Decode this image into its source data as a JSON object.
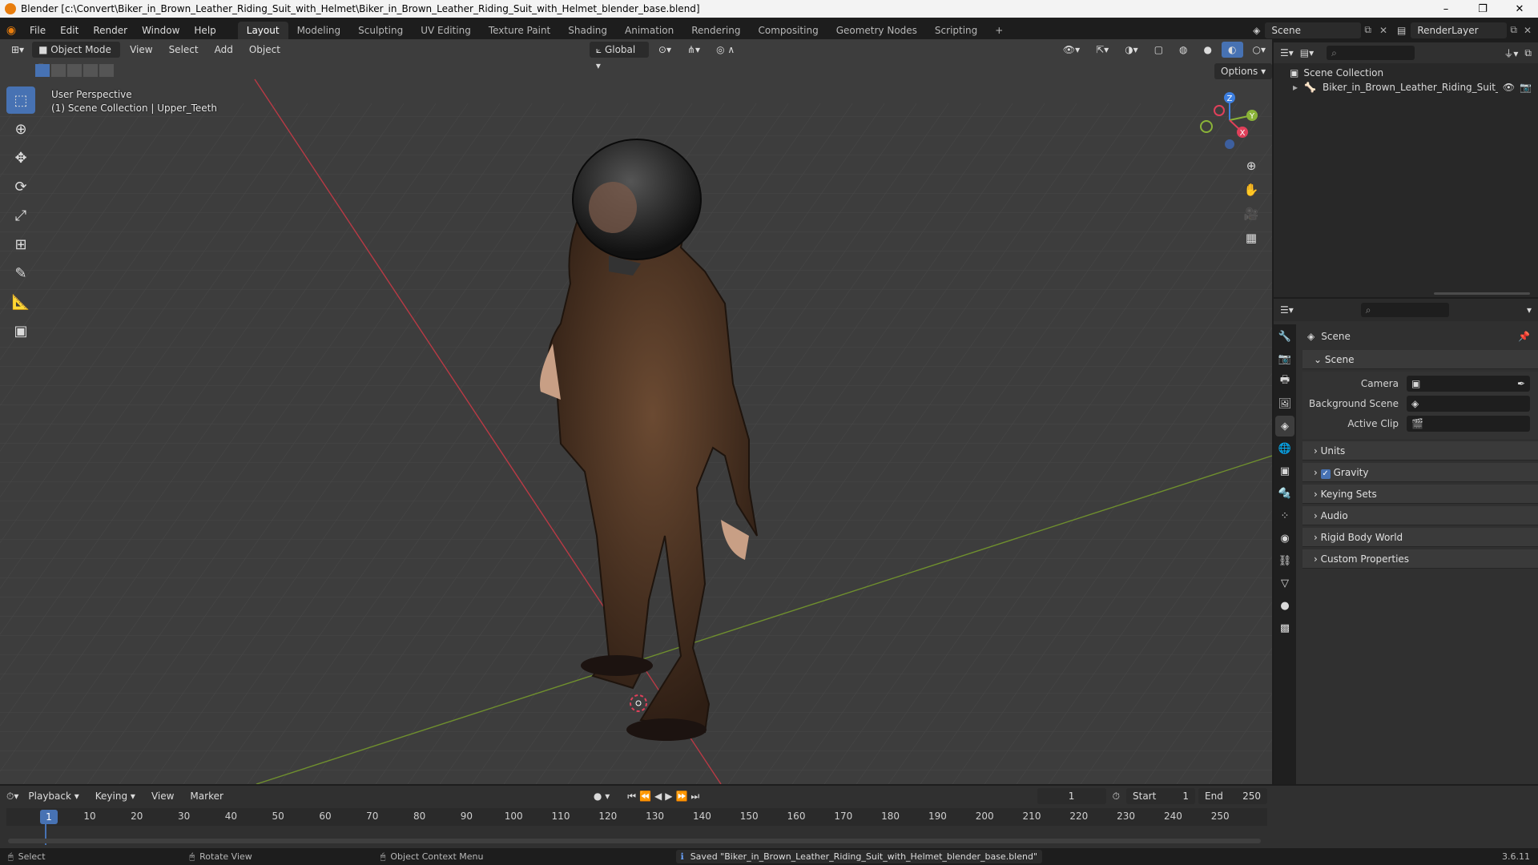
{
  "window": {
    "title": "Blender [c:\\Convert\\Biker_in_Brown_Leather_Riding_Suit_with_Helmet\\Biker_in_Brown_Leather_Riding_Suit_with_Helmet_blender_base.blend]",
    "minimize": "–",
    "maximize": "❐",
    "close": "✕"
  },
  "menu": [
    "File",
    "Edit",
    "Render",
    "Window",
    "Help"
  ],
  "workspaces": [
    {
      "label": "Layout",
      "active": true
    },
    {
      "label": "Modeling"
    },
    {
      "label": "Sculpting"
    },
    {
      "label": "UV Editing"
    },
    {
      "label": "Texture Paint"
    },
    {
      "label": "Shading"
    },
    {
      "label": "Animation"
    },
    {
      "label": "Rendering"
    },
    {
      "label": "Compositing"
    },
    {
      "label": "Geometry Nodes"
    },
    {
      "label": "Scripting"
    }
  ],
  "add_workspace": "+",
  "scene_selector": {
    "label": "Scene"
  },
  "renderlayer_selector": {
    "label": "RenderLayer"
  },
  "viewport": {
    "mode": "Object Mode",
    "menu": [
      "View",
      "Select",
      "Add",
      "Object"
    ],
    "transform_orientation": "Global",
    "options": "Options",
    "perspective_label": "User Perspective",
    "collection_label": "(1) Scene Collection | Upper_Teeth",
    "gizmo_axes": {
      "x": "X",
      "y": "Y",
      "z": "Z"
    }
  },
  "tools": [
    {
      "name": "select-box",
      "glyph": "⬚",
      "active": true
    },
    {
      "name": "cursor",
      "glyph": "⊕"
    },
    {
      "name": "move",
      "glyph": "✥"
    },
    {
      "name": "rotate",
      "glyph": "⟳"
    },
    {
      "name": "scale",
      "glyph": "⤢"
    },
    {
      "name": "transform",
      "glyph": "⊞"
    },
    {
      "name": "annotate",
      "glyph": "✎"
    },
    {
      "name": "measure",
      "glyph": "📐"
    },
    {
      "name": "add-cube",
      "glyph": "▣"
    }
  ],
  "outliner": {
    "root": "Scene Collection",
    "items": [
      {
        "label": "Biker_in_Brown_Leather_Riding_Suit_wi"
      }
    ]
  },
  "properties": {
    "header": "Scene",
    "scene_panel": {
      "title": "Scene",
      "fields": [
        {
          "label": "Camera",
          "value": ""
        },
        {
          "label": "Background Scene",
          "value": ""
        },
        {
          "label": "Active Clip",
          "value": ""
        }
      ]
    },
    "panels": [
      {
        "label": "Units"
      },
      {
        "label": "Gravity",
        "checkbox": true
      },
      {
        "label": "Keying Sets"
      },
      {
        "label": "Audio"
      },
      {
        "label": "Rigid Body World"
      },
      {
        "label": "Custom Properties"
      }
    ]
  },
  "timeline": {
    "menu": [
      "Playback",
      "Keying",
      "View",
      "Marker"
    ],
    "current_frame": "1",
    "start_label": "Start",
    "start_value": "1",
    "end_label": "End",
    "end_value": "250",
    "ticks": [
      "10",
      "20",
      "30",
      "40",
      "50",
      "60",
      "70",
      "80",
      "90",
      "100",
      "110",
      "120",
      "130",
      "140",
      "150",
      "160",
      "170",
      "180",
      "190",
      "200",
      "210",
      "220",
      "230",
      "240",
      "250"
    ],
    "playhead": "1"
  },
  "status": {
    "select": "Select",
    "rotate": "Rotate View",
    "context": "Object Context Menu",
    "message": "Saved \"Biker_in_Brown_Leather_Riding_Suit_with_Helmet_blender_base.blend\"",
    "version": "3.6.11"
  },
  "colors": {
    "accent": "#4772b3",
    "axis_x": "#e0405a",
    "axis_y": "#8ab338",
    "axis_z": "#3d7fe0",
    "viewport_bg": "#3d3d3d"
  }
}
